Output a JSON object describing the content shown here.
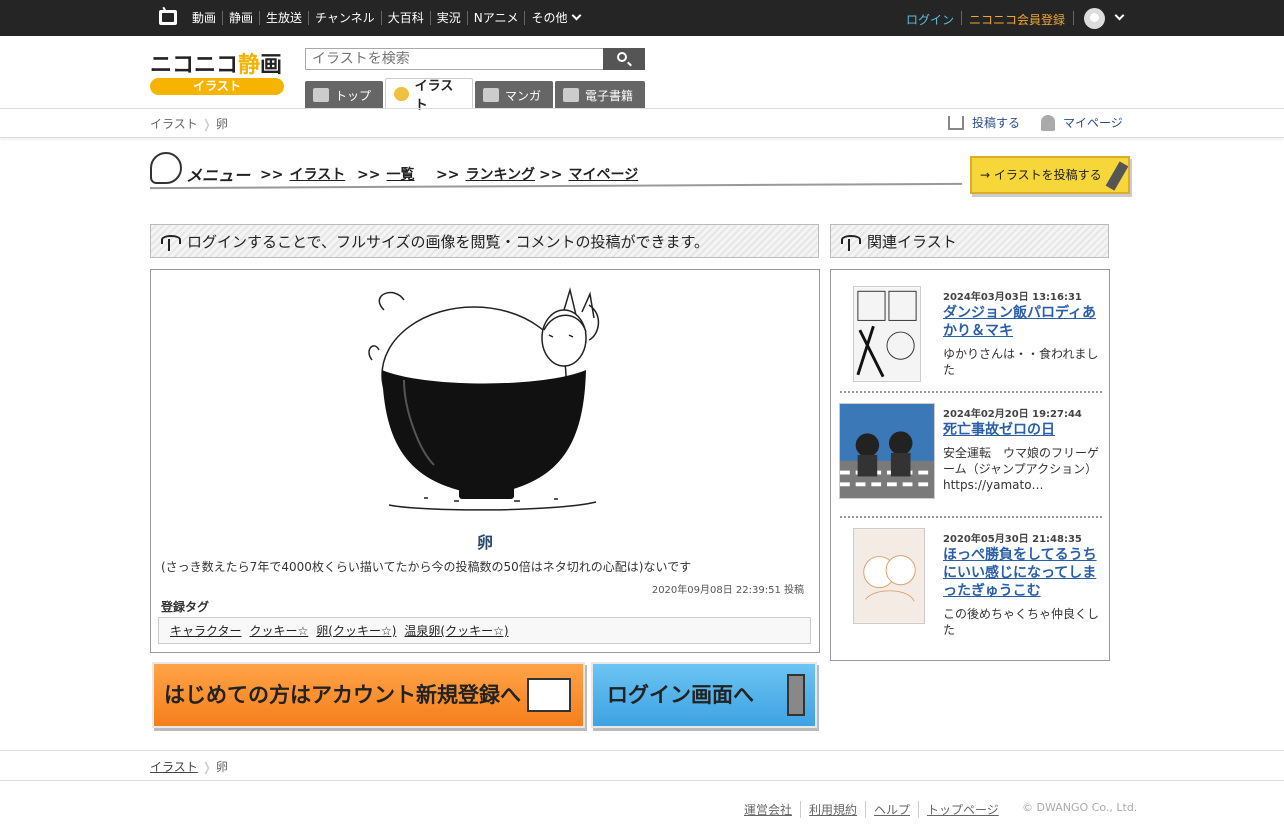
{
  "global_nav": {
    "items": [
      "動画",
      "静画",
      "生放送",
      "チャンネル",
      "大百科",
      "実況",
      "Nアニメ",
      "その他"
    ],
    "login": "ログイン",
    "register": "ニコニコ会員登録"
  },
  "logo": {
    "wordmark_a": "ニコニコ",
    "wordmark_b": "静",
    "wordmark_c": "画",
    "sub": "イラスト"
  },
  "search": {
    "placeholder": "イラストを検索"
  },
  "tabs": [
    {
      "label": "トップ"
    },
    {
      "label": "イラスト"
    },
    {
      "label": "マンガ"
    },
    {
      "label": "電子書籍"
    }
  ],
  "breadcrumb": {
    "root": "イラスト",
    "current": "卵"
  },
  "subnav": {
    "post": "投稿する",
    "mypage": "マイページ"
  },
  "menu": {
    "title": "メニュー",
    "prefix": ">>",
    "links": [
      "イラスト",
      "一覧",
      "ランキング",
      "マイページ"
    ],
    "post_button": "イラストを投稿する"
  },
  "notice": "ログインすることで、フルサイズの画像を閲覧・コメントの投稿ができます。",
  "illust": {
    "title": "卵",
    "description": "(さっき数えたら7年で4000枚くらい描いてたから今の投稿数の50倍はネタ切れの心配は)ないです",
    "posted": "2020年09月08日 22:39:51 投稿",
    "tags_label": "登録タグ",
    "tags": [
      "キャラクター",
      "クッキー☆",
      "卵(クッキー☆)",
      "温泉卵(クッキー☆)"
    ]
  },
  "banners": {
    "register": "はじめての方はアカウント新規登録へ",
    "login": "ログイン画面へ"
  },
  "related": {
    "heading": "関連イラスト",
    "items": [
      {
        "date": "2024年03月03日 13:16:31",
        "title": "ダンジョン飯パロディあかり＆マキ",
        "desc": "ゆかりさんは・・食われました"
      },
      {
        "date": "2024年02月20日 19:27:44",
        "title": "死亡事故ゼロの日",
        "desc": "安全運転　ウマ娘のフリーゲーム（ジャンプアクション）https://yamato…"
      },
      {
        "date": "2020年05月30日 21:48:35",
        "title": "ほっぺ勝負をしてるうちにいい感じになってしまったぎゅうこむ",
        "desc": "この後めちゃくちゃ仲良くした"
      }
    ]
  },
  "footer": {
    "links": [
      "運営会社",
      "利用規約",
      "ヘルプ",
      "トップページ"
    ],
    "copyright": "© DWANGO Co., Ltd."
  },
  "colors": {
    "topbar": "#252525",
    "login_link": "#5bc0de",
    "register_link": "#f0a830",
    "link_blue": "#2b5ea8",
    "brand_yellow": "#f6b400"
  },
  "icons": [
    "tv-logo-icon",
    "chevron-down-icon",
    "avatar-icon",
    "search-icon",
    "home-icon",
    "illust-icon",
    "manga-icon",
    "book-icon",
    "upload-icon",
    "user-icon",
    "palette-icon",
    "pen-icon",
    "sprout-icon"
  ]
}
